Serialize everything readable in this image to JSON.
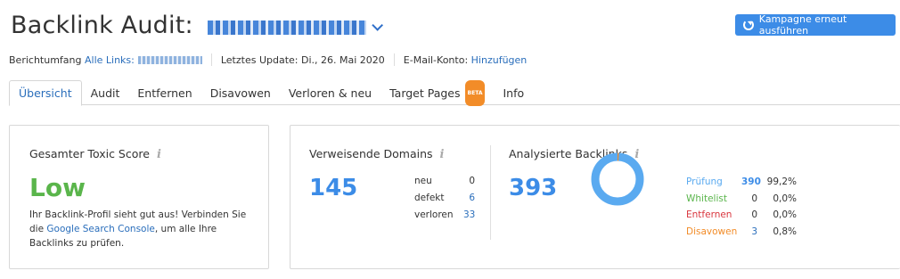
{
  "header": {
    "title": "Backlink Audit:",
    "rerun_label": "Kampagne erneut ausführen"
  },
  "meta": {
    "scope_label": "Berichtumfang",
    "scope_link": "Alle Links:",
    "updated_label": "Letztes Update: Di., 26. Mai 2020",
    "email_label": "E-Mail-Konto:",
    "email_link": "Hinzufügen"
  },
  "tabs": [
    {
      "label": "Übersicht"
    },
    {
      "label": "Audit"
    },
    {
      "label": "Entfernen"
    },
    {
      "label": "Disavowen"
    },
    {
      "label": "Verloren & neu"
    },
    {
      "label": "Target Pages",
      "badge": "BETA"
    },
    {
      "label": "Info"
    }
  ],
  "toxic": {
    "title": "Gesamter Toxic Score",
    "score": "Low",
    "desc_before": "Ihr Backlink-Profil sieht gut aus! Verbinden Sie die ",
    "desc_link": "Google Search Console",
    "desc_after": ", um alle Ihre Backlinks zu prüfen."
  },
  "referring": {
    "title": "Verweisende Domains",
    "total": "145",
    "rows": [
      {
        "label": "neu",
        "value": "0"
      },
      {
        "label": "defekt",
        "value": "6"
      },
      {
        "label": "verloren",
        "value": "33"
      }
    ]
  },
  "backlinks": {
    "title": "Analysierte Backlinks",
    "total": "393",
    "legend": [
      {
        "label": "Prüfung",
        "value": "390",
        "pct": "99,2%",
        "color": "#5aaaf0"
      },
      {
        "label": "Whitelist",
        "value": "0",
        "pct": "0,0%",
        "color": "#5ab54b"
      },
      {
        "label": "Entfernen",
        "value": "0",
        "pct": "0,0%",
        "color": "#d9363e"
      },
      {
        "label": "Disavowen",
        "value": "3",
        "pct": "0,8%",
        "color": "#f28c28"
      }
    ]
  },
  "icons": {
    "info": "i",
    "refresh": "refresh-icon",
    "chevron": "chevron-down-icon"
  },
  "colors": {
    "accent": "#3c8ce7",
    "link": "#2a6ebb",
    "good": "#5ab54b"
  }
}
